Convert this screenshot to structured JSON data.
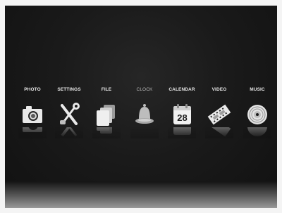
{
  "menu": {
    "items": [
      {
        "label": "PHOTO",
        "icon": "camera-icon"
      },
      {
        "label": "SETTINGS",
        "icon": "tools-icon"
      },
      {
        "label": "FILE",
        "icon": "folder-icon"
      },
      {
        "label": "CLOCK",
        "icon": "bell-icon"
      },
      {
        "label": "CALENDAR",
        "icon": "calendar-icon",
        "day": "28"
      },
      {
        "label": "VIDEO",
        "icon": "film-icon"
      },
      {
        "label": "MUSIC",
        "icon": "disc-icon"
      }
    ],
    "selected_index": 3
  }
}
